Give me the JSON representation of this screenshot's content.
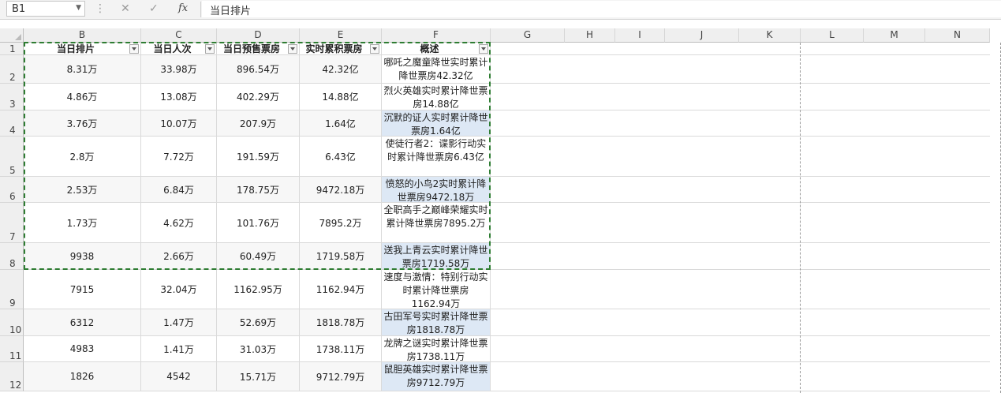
{
  "formula_bar": {
    "name_box": "B1",
    "formula": "当日排片"
  },
  "columns": [
    "B",
    "C",
    "D",
    "E",
    "F",
    "G",
    "H",
    "I",
    "J",
    "K",
    "L",
    "M",
    "N"
  ],
  "headers": [
    "当日排片",
    "当日人次",
    "当日预售票房",
    "实时累积票房",
    "概述"
  ],
  "rows": [
    {
      "num": "1"
    },
    {
      "num": "2",
      "b": "8.31万",
      "c": "33.98万",
      "d": "896.54万",
      "e": "42.32亿",
      "f": "哪吒之魔童降世实时累计降世票房42.32亿"
    },
    {
      "num": "3",
      "b": "4.86万",
      "c": "13.08万",
      "d": "402.29万",
      "e": "14.88亿",
      "f": "烈火英雄实时累计降世票房14.88亿"
    },
    {
      "num": "4",
      "b": "3.76万",
      "c": "10.07万",
      "d": "207.9万",
      "e": "1.64亿",
      "f": "沉默的证人实时累计降世票房1.64亿"
    },
    {
      "num": "5",
      "b": "2.8万",
      "c": "7.72万",
      "d": "191.59万",
      "e": "6.43亿",
      "f": "使徒行者2：谍影行动实时累计降世票房6.43亿"
    },
    {
      "num": "6",
      "b": "2.53万",
      "c": "6.84万",
      "d": "178.75万",
      "e": "9472.18万",
      "f": "愤怒的小鸟2实时累计降世票房9472.18万"
    },
    {
      "num": "7",
      "b": "1.73万",
      "c": "4.62万",
      "d": "101.76万",
      "e": "7895.2万",
      "f": "全职高手之巅峰荣耀实时累计降世票房7895.2万"
    },
    {
      "num": "8",
      "b": "9938",
      "c": "2.66万",
      "d": "60.49万",
      "e": "1719.58万",
      "f": "送我上青云实时累计降世票房1719.58万"
    },
    {
      "num": "9",
      "b": "7915",
      "c": "32.04万",
      "d": "1162.95万",
      "e": "1162.94万",
      "f": "速度与激情：特别行动实时累计降世票房1162.94万"
    },
    {
      "num": "10",
      "b": "6312",
      "c": "1.47万",
      "d": "52.69万",
      "e": "1818.78万",
      "f": "古田军号实时累计降世票房1818.78万"
    },
    {
      "num": "11",
      "b": "4983",
      "c": "1.41万",
      "d": "31.03万",
      "e": "1738.11万",
      "f": "龙牌之谜实时累计降世票房1738.11万"
    },
    {
      "num": "12",
      "b": "1826",
      "c": "4542",
      "d": "15.71万",
      "e": "9712.79万",
      "f": "鼠胆英雄实时累计降世票房9712.79万"
    }
  ]
}
